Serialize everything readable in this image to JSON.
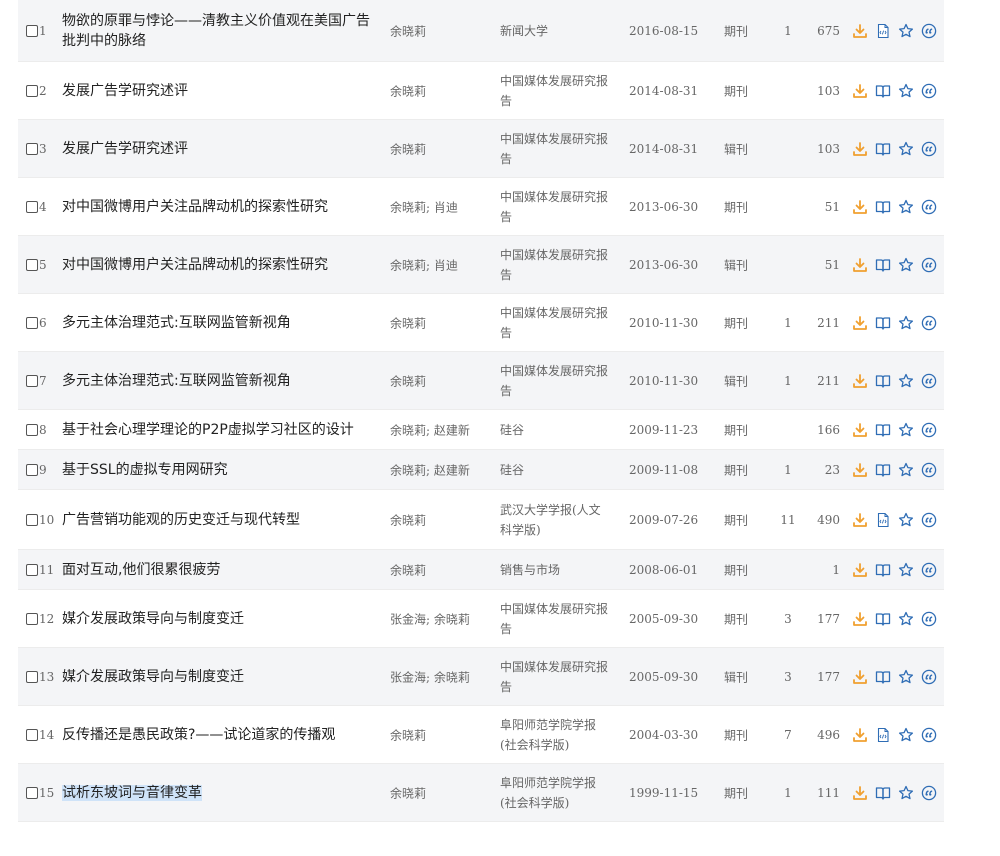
{
  "accent_colors": {
    "download": "#f0a030",
    "icon_blue": "#2f6db5",
    "highlight": "#cfe3f8"
  },
  "rows": [
    {
      "num": "1",
      "title": "物欲的原罪与悖论——清教主义价值观在美国广告批判中的脉络",
      "author": "余晓莉",
      "source": "新闻大学",
      "date": "2016-08-15",
      "type": "期刊",
      "cited": "1",
      "downloads": "675",
      "read_icon": "html-icon"
    },
    {
      "num": "2",
      "title": "发展广告学研究述评",
      "author": "余晓莉",
      "source": "中国媒体发展研究报告",
      "date": "2014-08-31",
      "type": "期刊",
      "cited": "",
      "downloads": "103",
      "read_icon": "book-icon"
    },
    {
      "num": "3",
      "title": "发展广告学研究述评",
      "author": "余晓莉",
      "source": "中国媒体发展研究报告",
      "date": "2014-08-31",
      "type": "辑刊",
      "cited": "",
      "downloads": "103",
      "read_icon": "book-icon"
    },
    {
      "num": "4",
      "title": "对中国微博用户关注品牌动机的探索性研究",
      "author": "余晓莉; 肖迪",
      "source": "中国媒体发展研究报告",
      "date": "2013-06-30",
      "type": "期刊",
      "cited": "",
      "downloads": "51",
      "read_icon": "book-icon"
    },
    {
      "num": "5",
      "title": "对中国微博用户关注品牌动机的探索性研究",
      "author": "余晓莉; 肖迪",
      "source": "中国媒体发展研究报告",
      "date": "2013-06-30",
      "type": "辑刊",
      "cited": "",
      "downloads": "51",
      "read_icon": "book-icon"
    },
    {
      "num": "6",
      "title": "多元主体治理范式:互联网监管新视角",
      "author": "余晓莉",
      "source": "中国媒体发展研究报告",
      "date": "2010-11-30",
      "type": "期刊",
      "cited": "1",
      "downloads": "211",
      "read_icon": "book-icon"
    },
    {
      "num": "7",
      "title": "多元主体治理范式:互联网监管新视角",
      "author": "余晓莉",
      "source": "中国媒体发展研究报告",
      "date": "2010-11-30",
      "type": "辑刊",
      "cited": "1",
      "downloads": "211",
      "read_icon": "book-icon"
    },
    {
      "num": "8",
      "title": "基于社会心理学理论的P2P虚拟学习社区的设计",
      "author": "余晓莉; 赵建新",
      "source": "硅谷",
      "date": "2009-11-23",
      "type": "期刊",
      "cited": "",
      "downloads": "166",
      "read_icon": "book-icon"
    },
    {
      "num": "9",
      "title": "基于SSL的虚拟专用网研究",
      "author": "余晓莉; 赵建新",
      "source": "硅谷",
      "date": "2009-11-08",
      "type": "期刊",
      "cited": "1",
      "downloads": "23",
      "read_icon": "book-icon"
    },
    {
      "num": "10",
      "title": "广告营销功能观的历史变迁与现代转型",
      "author": "余晓莉",
      "source": "武汉大学学报(人文科学版)",
      "date": "2009-07-26",
      "type": "期刊",
      "cited": "11",
      "downloads": "490",
      "read_icon": "html-icon"
    },
    {
      "num": "11",
      "title": "面对互动,他们很累很疲劳",
      "author": "余晓莉",
      "source": "销售与市场",
      "date": "2008-06-01",
      "type": "期刊",
      "cited": "",
      "downloads": "1",
      "read_icon": "book-icon"
    },
    {
      "num": "12",
      "title": "媒介发展政策导向与制度变迁",
      "author": "张金海; 余晓莉",
      "source": "中国媒体发展研究报告",
      "date": "2005-09-30",
      "type": "期刊",
      "cited": "3",
      "downloads": "177",
      "read_icon": "book-icon"
    },
    {
      "num": "13",
      "title": "媒介发展政策导向与制度变迁",
      "author": "张金海; 余晓莉",
      "source": "中国媒体发展研究报告",
      "date": "2005-09-30",
      "type": "辑刊",
      "cited": "3",
      "downloads": "177",
      "read_icon": "book-icon"
    },
    {
      "num": "14",
      "title": "反传播还是愚民政策?——试论道家的传播观",
      "author": "余晓莉",
      "source": "阜阳师范学院学报(社会科学版)",
      "date": "2004-03-30",
      "type": "期刊",
      "cited": "7",
      "downloads": "496",
      "read_icon": "html-icon"
    },
    {
      "num": "15",
      "title": "试析东坡词与音律变革",
      "author": "余晓莉",
      "source": "阜阳师范学院学报(社会科学版)",
      "date": "1999-11-15",
      "type": "期刊",
      "cited": "1",
      "downloads": "111",
      "read_icon": "book-icon",
      "highlighted": true
    }
  ]
}
